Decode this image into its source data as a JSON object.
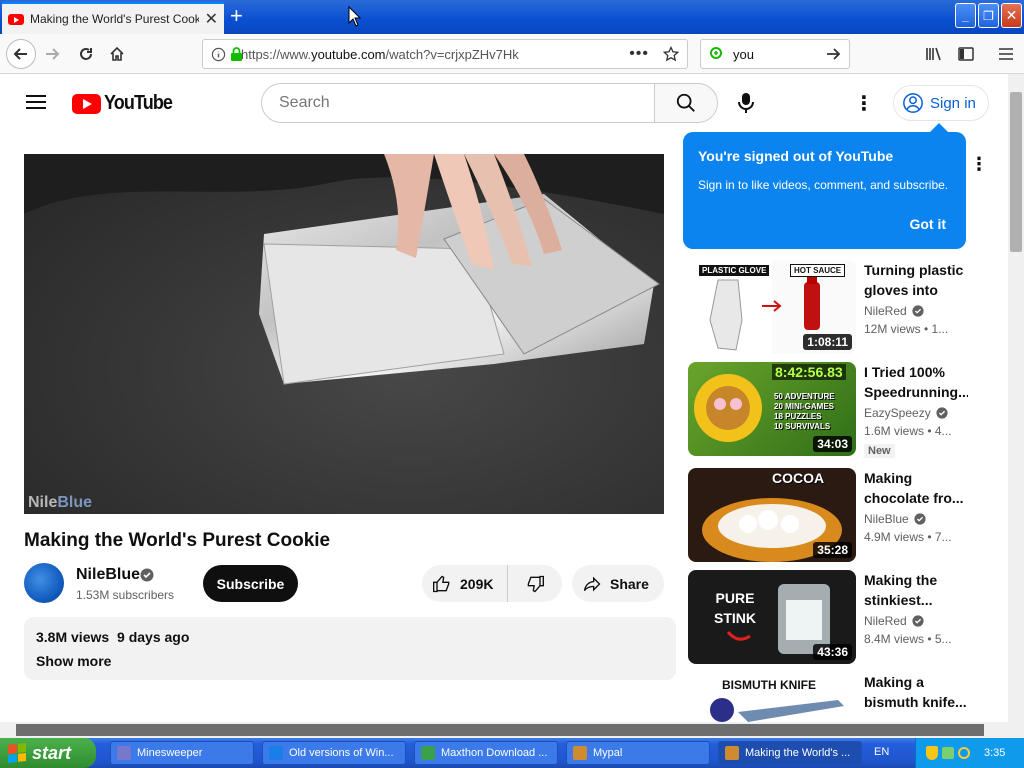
{
  "browser": {
    "tab_title": "Making the World's Purest Cookie",
    "new_tab_symbol": "+",
    "url_prefix": "https://www.",
    "url_domain": "youtube.com",
    "url_path": "/watch?v=crjxpZHv7Hk",
    "search_value": "you",
    "window_buttons": {
      "minimize": "_",
      "maximize": "❐",
      "close": "✕"
    }
  },
  "youtube": {
    "logo_text": "YouTube",
    "search_placeholder": "Search",
    "signin_label": "Sign in",
    "popup": {
      "title": "You're signed out of YouTube",
      "body": "Sign in to like videos, comment, and subscribe.",
      "button": "Got it"
    }
  },
  "video": {
    "title": "Making the World's Purest Cookie",
    "watermark_a": "Nile",
    "watermark_b": "Blue",
    "channel": "NileBlue",
    "subscribers": "1.53M subscribers",
    "subscribe_label": "Subscribe",
    "likes": "209K",
    "share_label": "Share",
    "views": "3.8M views",
    "age": "9 days ago",
    "show_more": "Show more"
  },
  "related": [
    {
      "title": "Turning plastic gloves into ho...",
      "channel": "NileRed",
      "stats": "12M views • 1...",
      "duration": "1:08:11",
      "label_a": "PLASTIC GLOVE",
      "label_b": "HOT SAUCE"
    },
    {
      "title": "I Tried 100% Speedrunning...",
      "channel": "EazySpeezy",
      "stats": "1.6M views • 4...",
      "duration": "34:03",
      "badge": "New",
      "label_a": "8:42:56.83",
      "label_b": "50 ADVENTURE\n20 MINI-GAMES\n18 PUZZLES\n10 SURVIVALS"
    },
    {
      "title": "Making chocolate fro...",
      "channel": "NileBlue",
      "stats": "4.9M views • 7...",
      "duration": "35:28",
      "label_a": "COCOA"
    },
    {
      "title": "Making the stinkiest...",
      "channel": "NileRed",
      "stats": "8.4M views • 5...",
      "duration": "43:36",
      "label_a": "PURE\nSTINK"
    },
    {
      "title": "Making a bismuth knife...",
      "channel": "",
      "stats": "",
      "duration": "",
      "label_a": "BISMUTH KNIFE"
    }
  ],
  "taskbar": {
    "start_label": "start",
    "tasks": [
      "Minesweeper",
      "Old versions of Win...",
      "Maxthon Download ...",
      "Mypal",
      "Making the World's ..."
    ],
    "language": "EN",
    "clock": "3:35"
  },
  "colors": {
    "accent": "#065fd4",
    "popup": "#0b84ef",
    "brand_red": "#ff0000"
  }
}
